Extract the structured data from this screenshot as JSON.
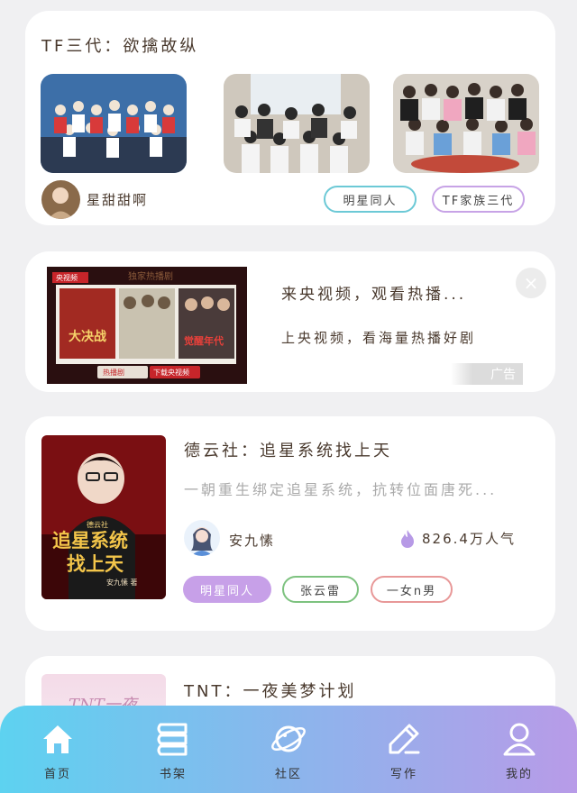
{
  "feed": {
    "card1": {
      "title": "TF三代：欲擒故纵",
      "author": "星甜甜啊",
      "tags": [
        "明星同人",
        "TF家族三代"
      ]
    },
    "ad": {
      "title": "来央视频，观看热播...",
      "description": "上央视频，看海量热播好剧",
      "badge": "广告",
      "close": "×",
      "image": {
        "logo": "央视频",
        "banner": "独家热播剧",
        "posters": [
          "大决战",
          "",
          "觉醒年代"
        ],
        "button_left": "热播剧",
        "button_right": "下载央视频"
      }
    },
    "card3": {
      "title": "德云社：追星系统找上天",
      "description": "一朝重生绑定追星系统，抗转位面唐死...",
      "author": "安九愫",
      "popularity": "826.4万人气",
      "cover_text": [
        "追星系统",
        "找上天"
      ],
      "cover_author": "安九愫 著",
      "cover_series": "德云社",
      "tags": [
        "明星同人",
        "张云雷",
        "一女n男"
      ]
    },
    "card4": {
      "title": "TNT：一夜美梦计划",
      "cover_text": "TNT一夜"
    }
  },
  "tabbar": {
    "home": "首页",
    "bookshelf": "书架",
    "community": "社区",
    "write": "写作",
    "mine": "我的"
  },
  "colors": {
    "tag_teal": "#6cc9d6",
    "tag_purple": "#c7a3e6",
    "tag_filled": "#c7a0e8",
    "tag_green": "#7dc27f",
    "tag_pink": "#e89898",
    "tabbar_start": "#5dd2f0",
    "tabbar_end": "#b89be8"
  },
  "icons": [
    "home-icon",
    "bookshelf-icon",
    "planet-icon",
    "pencil-icon",
    "user-icon",
    "fire-icon",
    "close-icon"
  ]
}
